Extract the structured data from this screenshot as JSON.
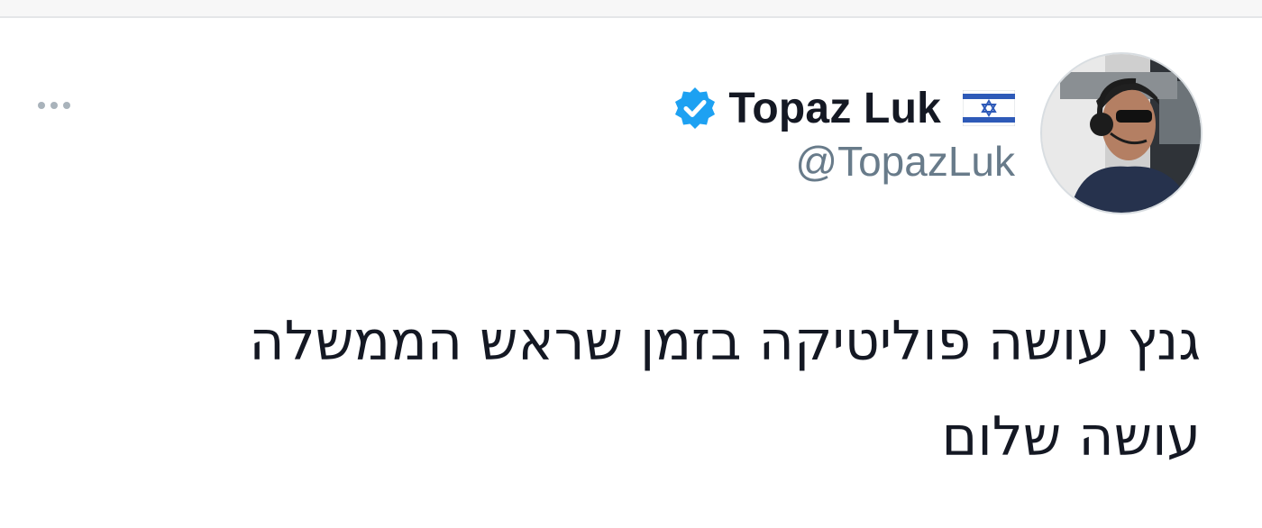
{
  "tweet": {
    "author": {
      "display_name": "Topaz Luk",
      "handle": "@TopazLuk",
      "verified": true,
      "flag_emoji": "🇮🇱",
      "avatar_icon": "person-with-headset-avatar"
    },
    "text_lines": [
      "גנץ עושה פוליטיקה בזמן שראש הממשלה",
      "עושה שלום"
    ],
    "more_icon": "ellipsis-icon"
  },
  "colors": {
    "verified_blue": "#1da1f2",
    "text_primary": "#141823",
    "text_secondary": "#687b8a",
    "more_dots": "#a9b3bb",
    "flag_blue": "#2e5ab8"
  }
}
